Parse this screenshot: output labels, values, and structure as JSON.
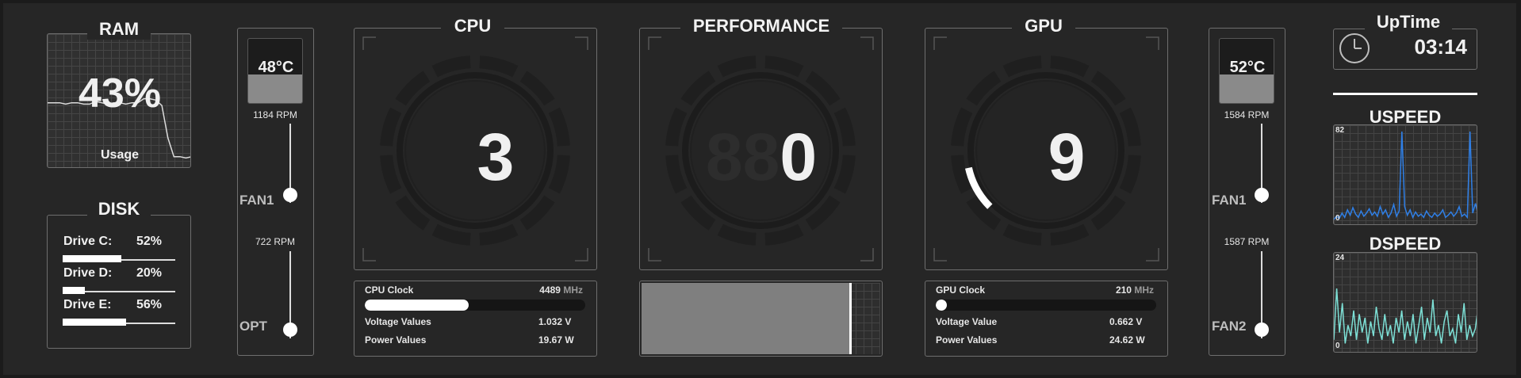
{
  "colors": {
    "background": "#262626",
    "border": "#6e6e6e",
    "text": "#f0f0f0",
    "upload_line": "#2f7fe6",
    "download_line": "#7de0d6",
    "gauge_arc": "#ffffff"
  },
  "ram": {
    "title": "RAM",
    "value": "43%",
    "caption": "Usage",
    "usage_history": [
      49,
      49,
      49,
      48,
      49,
      49,
      48,
      48,
      50,
      49,
      48,
      49,
      49,
      48,
      49,
      49,
      52,
      52,
      51,
      47,
      23,
      9,
      9,
      8,
      9
    ]
  },
  "disk": {
    "title": "DISK",
    "drives": [
      {
        "name": "Drive C:",
        "percent_label": "52%",
        "percent": 52
      },
      {
        "name": "Drive D:",
        "percent_label": "20%",
        "percent": 20
      },
      {
        "name": "Drive E:",
        "percent_label": "56%",
        "percent": 56
      }
    ]
  },
  "cpu_fans": {
    "temperature": "48°C",
    "temperature_fill": 0.45,
    "fan1": {
      "rpm": "1184 RPM",
      "label": "FAN1",
      "level": 0.1
    },
    "fan2": {
      "rpm": "722 RPM",
      "label": "OPT",
      "level": 0.1
    }
  },
  "cpu": {
    "title": "CPU",
    "value": "3",
    "gauge_fraction": 0.0,
    "clock_label": "CPU Clock",
    "clock_value": "4489",
    "clock_unit": "MHz",
    "clock_fill": 0.47,
    "voltage_label": "Voltage Values",
    "voltage_value": "1.032 V",
    "power_label": "Power Values",
    "power_value": "19.67 W"
  },
  "performance": {
    "title": "PERFORMANCE",
    "value_ghost": "88",
    "value": "0",
    "history_fill": 0.87
  },
  "gpu": {
    "title": "GPU",
    "value": "9",
    "gauge_fraction": 0.09,
    "clock_label": "GPU Clock",
    "clock_value": "210",
    "clock_unit": "MHz",
    "clock_fill": 0.05,
    "voltage_label": "Voltage Value",
    "voltage_value": "0.662 V",
    "power_label": "Power Values",
    "power_value": "24.62 W"
  },
  "gpu_fans": {
    "temperature": "52°C",
    "temperature_fill": 0.45,
    "fan1": {
      "rpm": "1584 RPM",
      "label": "FAN1",
      "level": 0.1
    },
    "fan2": {
      "rpm": "1587 RPM",
      "label": "FAN2",
      "level": 0.1
    }
  },
  "uptime": {
    "title": "UpTime",
    "value": "03:14",
    "icon": "clock-icon"
  },
  "uspeed": {
    "title": "USPEED",
    "max_label": "82",
    "min_label": "0",
    "max": 82,
    "values": [
      0,
      3,
      1,
      6,
      2,
      9,
      4,
      11,
      5,
      2,
      8,
      3,
      6,
      10,
      4,
      7,
      3,
      12,
      5,
      9,
      2,
      6,
      14,
      3,
      8,
      82,
      12,
      4,
      9,
      2,
      7,
      3,
      5,
      2,
      8,
      4,
      2,
      6,
      3,
      5,
      9,
      2,
      4,
      7,
      3,
      6,
      12,
      3,
      5,
      2,
      82,
      6,
      15,
      4
    ]
  },
  "dspeed": {
    "title": "DSPEED",
    "max_label": "24",
    "min_label": "0",
    "max": 24,
    "values": [
      2,
      16,
      4,
      12,
      1,
      6,
      3,
      10,
      2,
      9,
      4,
      8,
      1,
      7,
      3,
      11,
      5,
      2,
      9,
      3,
      6,
      1,
      8,
      4,
      10,
      2,
      7,
      3,
      9,
      1,
      6,
      11,
      2,
      8,
      4,
      13,
      3,
      6,
      1,
      7,
      10,
      3,
      5,
      1,
      9,
      4,
      12,
      2,
      6,
      3,
      5,
      11
    ]
  }
}
